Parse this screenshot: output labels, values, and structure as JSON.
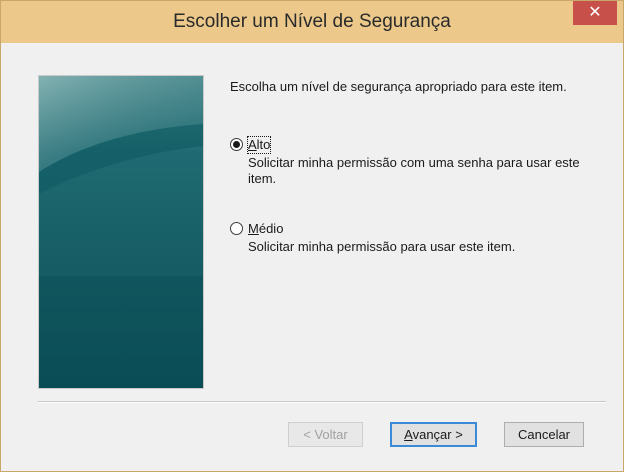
{
  "window": {
    "title": "Escolher um Nível de Segurança",
    "close_glyph": "✕"
  },
  "content": {
    "intro": "Escolha um nível de segurança apropriado para este item.",
    "options": [
      {
        "label_first": "A",
        "label_rest": "lto",
        "description": "Solicitar minha permissão com uma senha para usar este item.",
        "selected": true
      },
      {
        "label_first": "M",
        "label_rest": "édio",
        "description": "Solicitar minha permissão para usar este item.",
        "selected": false
      }
    ]
  },
  "buttons": {
    "back": "< Voltar",
    "next_first": "A",
    "next_rest": "vançar >",
    "cancel": "Cancelar"
  },
  "colors": {
    "titlebar": "#ecc98b",
    "close": "#c7504b",
    "panel_dark": "#0d4a52",
    "panel_light": "#2a7078"
  },
  "icons": [
    "close-icon",
    "radio-checked-icon",
    "radio-unchecked-icon"
  ]
}
